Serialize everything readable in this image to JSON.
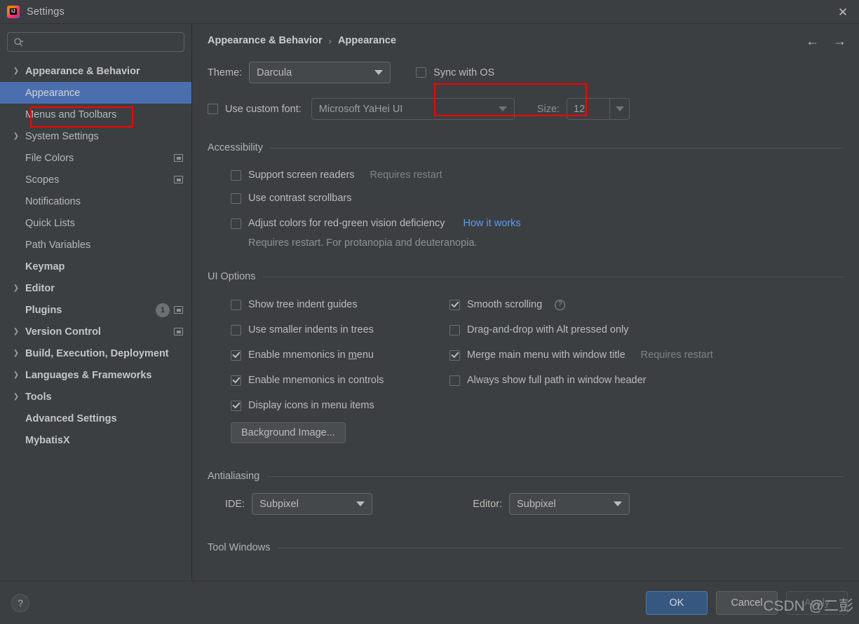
{
  "window": {
    "title": "Settings",
    "logo_icon": "intellij-idea-logo-icon",
    "close_icon": "close-icon"
  },
  "sidebar": {
    "search": {
      "placeholder": "",
      "value": "",
      "icon": "search-icon"
    },
    "items": [
      {
        "label": "Appearance & Behavior",
        "level": 0,
        "expanded": true,
        "bold": true,
        "selected": false,
        "arrow": "chevron-down-icon"
      },
      {
        "label": "Appearance",
        "level": 1,
        "selected": true,
        "arrow": ""
      },
      {
        "label": "Menus and Toolbars",
        "level": 1,
        "selected": false,
        "arrow": ""
      },
      {
        "label": "System Settings",
        "level": 1,
        "selected": false,
        "arrow": "chevron-right-icon"
      },
      {
        "label": "File Colors",
        "level": 1,
        "selected": false,
        "arrow": "",
        "trailing_icon": "project-scope-icon"
      },
      {
        "label": "Scopes",
        "level": 1,
        "selected": false,
        "arrow": "",
        "trailing_icon": "project-scope-icon"
      },
      {
        "label": "Notifications",
        "level": 1,
        "selected": false,
        "arrow": ""
      },
      {
        "label": "Quick Lists",
        "level": 1,
        "selected": false,
        "arrow": ""
      },
      {
        "label": "Path Variables",
        "level": 1,
        "selected": false,
        "arrow": ""
      },
      {
        "label": "Keymap",
        "level": 0,
        "bold": true,
        "selected": false,
        "arrow": ""
      },
      {
        "label": "Editor",
        "level": 0,
        "bold": true,
        "selected": false,
        "arrow": "chevron-right-icon"
      },
      {
        "label": "Plugins",
        "level": 0,
        "bold": true,
        "selected": false,
        "arrow": "",
        "badge": "1",
        "trailing_icon": "project-scope-icon"
      },
      {
        "label": "Version Control",
        "level": 0,
        "bold": true,
        "selected": false,
        "arrow": "chevron-right-icon",
        "trailing_icon": "project-scope-icon"
      },
      {
        "label": "Build, Execution, Deployment",
        "level": 0,
        "bold": true,
        "selected": false,
        "arrow": "chevron-right-icon"
      },
      {
        "label": "Languages & Frameworks",
        "level": 0,
        "bold": true,
        "selected": false,
        "arrow": "chevron-right-icon"
      },
      {
        "label": "Tools",
        "level": 0,
        "bold": true,
        "selected": false,
        "arrow": "chevron-right-icon"
      },
      {
        "label": "Advanced Settings",
        "level": 0,
        "bold": true,
        "selected": false,
        "arrow": ""
      },
      {
        "label": "MybatisX",
        "level": 0,
        "bold": true,
        "selected": false,
        "arrow": ""
      }
    ]
  },
  "main": {
    "breadcrumb": {
      "root": "Appearance & Behavior",
      "separator": "›",
      "leaf": "Appearance"
    },
    "nav": {
      "back_icon": "arrow-left-icon",
      "forward_icon": "arrow-right-icon"
    },
    "theme": {
      "label": "Theme:",
      "value": "Darcula",
      "sync_with_os_label": "Sync with OS",
      "sync_with_os_checked": false
    },
    "custom_font": {
      "label": "Use custom font:",
      "checked": false,
      "value": "Microsoft YaHei UI",
      "size_label": "Size:",
      "size_value": "12"
    },
    "accessibility": {
      "title": "Accessibility",
      "options": [
        {
          "label": "Support screen readers",
          "checked": false,
          "hint": "Requires restart"
        },
        {
          "label": "Use contrast scrollbars",
          "checked": false
        },
        {
          "label": "Adjust colors for red-green vision deficiency",
          "checked": false,
          "link": "How it works"
        }
      ],
      "note": "Requires restart. For protanopia and deuteranopia."
    },
    "ui_options": {
      "title": "UI Options",
      "left": [
        {
          "label": "Show tree indent guides",
          "checked": false
        },
        {
          "label": "Use smaller indents in trees",
          "checked": false
        },
        {
          "label_pre": "Enable mnemonics in ",
          "mnemonic": "m",
          "label_post": "enu",
          "checked": true
        },
        {
          "label": "Enable mnemonics in controls",
          "checked": true
        },
        {
          "label": "Display icons in menu items",
          "checked": true
        }
      ],
      "right": [
        {
          "label": "Smooth scrolling",
          "checked": true,
          "help_icon": "help-circle-icon"
        },
        {
          "label": "Drag-and-drop with Alt pressed only",
          "checked": false
        },
        {
          "label": "Merge main menu with window title",
          "checked": true,
          "hint": "Requires restart"
        },
        {
          "label": "Always show full path in window header",
          "checked": false
        }
      ],
      "background_image_button": "Background Image..."
    },
    "antialiasing": {
      "title": "Antialiasing",
      "ide_label": "IDE:",
      "ide_value": "Subpixel",
      "editor_label": "Editor:",
      "editor_value": "Subpixel"
    },
    "tool_windows": {
      "title": "Tool Windows"
    }
  },
  "footer": {
    "help_icon": "question-mark-icon",
    "ok": "OK",
    "cancel": "Cancel",
    "apply": "Apply"
  },
  "watermark": "CSDN @二彭",
  "colors": {
    "selection": "#4b6eaf",
    "primary_button": "#365880",
    "annotation": "#ff0000",
    "link": "#589df6",
    "background": "#3c3f41"
  }
}
